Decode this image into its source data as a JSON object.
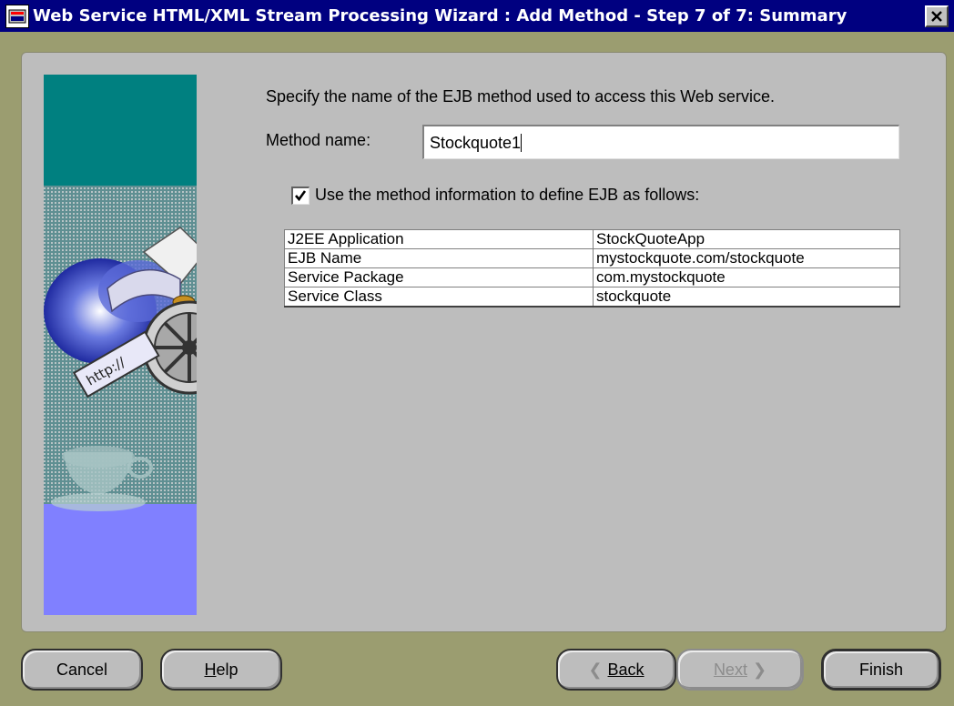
{
  "window": {
    "title": "Web Service HTML/XML Stream Processing Wizard : Add Method - Step 7 of 7: Summary"
  },
  "content": {
    "instruction": "Specify the name of the EJB method used to access this Web service.",
    "method_name_label": "Method name:",
    "method_name_value": "Stockquote1",
    "use_method_info_label": "Use the method information to define EJB as follows:",
    "use_method_info_checked": true,
    "ejb_table": [
      {
        "key": "J2EE Application",
        "value": "StockQuoteApp"
      },
      {
        "key": "EJB Name",
        "value": "mystockquote.com/stockquote"
      },
      {
        "key": "Service Package",
        "value": "com.mystockquote"
      },
      {
        "key": "Service Class",
        "value": "stockquote"
      }
    ]
  },
  "buttons": {
    "cancel": "Cancel",
    "help": "Help",
    "back": "Back",
    "next": "Next",
    "finish": "Finish"
  },
  "colors": {
    "titlebar": "#000080",
    "frame": "#9b9d70",
    "panel": "#bdbdbd",
    "side_teal": "#008080",
    "side_lavender": "#8080ff"
  }
}
